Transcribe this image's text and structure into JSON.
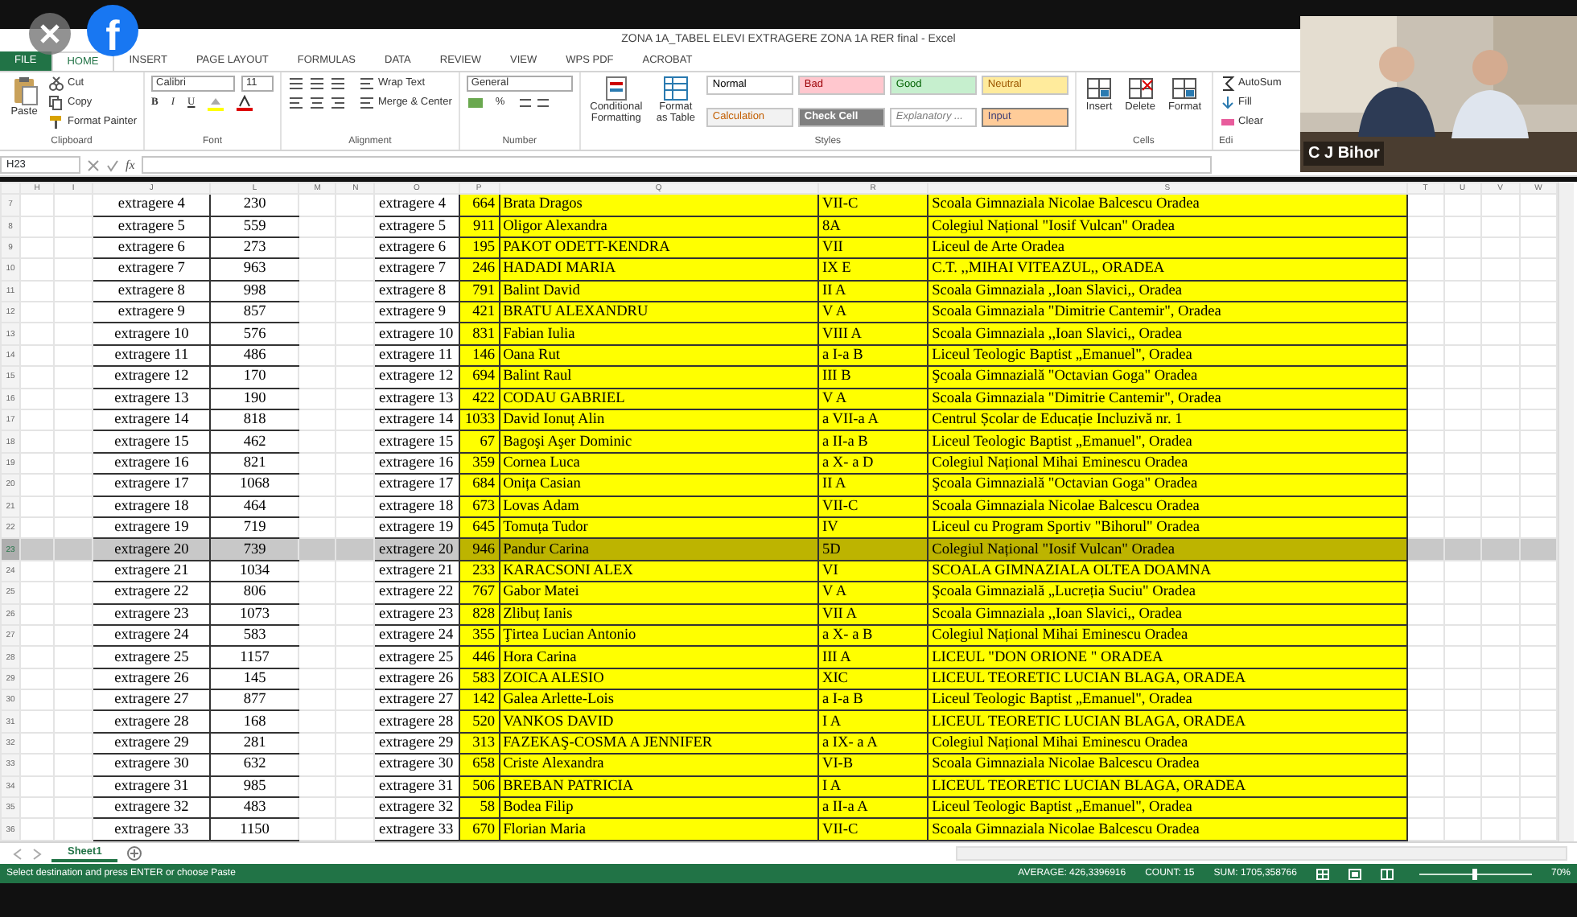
{
  "overlay": {
    "logo_text": "f"
  },
  "camera": {
    "kind": "picture",
    "caption": "C J Bihor"
  },
  "window": {
    "title": "ZONA 1A_TABEL ELEVI EXTRAGERE ZONA 1A RER final - Excel"
  },
  "ribbon_tabs": [
    {
      "label": "FILE",
      "kind": "file",
      "selected": false
    },
    {
      "label": "HOME",
      "kind": "tab",
      "selected": true
    },
    {
      "label": "INSERT",
      "kind": "tab",
      "selected": false
    },
    {
      "label": "PAGE LAYOUT",
      "kind": "tab",
      "selected": false
    },
    {
      "label": "FORMULAS",
      "kind": "tab",
      "selected": false
    },
    {
      "label": "DATA",
      "kind": "tab",
      "selected": false
    },
    {
      "label": "REVIEW",
      "kind": "tab",
      "selected": false
    },
    {
      "label": "VIEW",
      "kind": "tab",
      "selected": false
    },
    {
      "label": "WPS PDF",
      "kind": "tab",
      "selected": false
    },
    {
      "label": "ACROBAT",
      "kind": "tab",
      "selected": false
    }
  ],
  "ribbon": [
    {
      "kind": "clipboard",
      "label": "Clipboard",
      "items": [
        "Paste",
        "Cut",
        "Copy",
        "Format Painter"
      ]
    },
    {
      "kind": "font",
      "label": "Font",
      "items": [
        "Calibri",
        "11",
        "B",
        "I",
        "U"
      ]
    },
    {
      "kind": "alignment",
      "label": "Alignment",
      "items": [
        "Wrap Text",
        "Merge & Center"
      ]
    },
    {
      "kind": "number",
      "label": "Number",
      "items": [
        "General",
        "%"
      ]
    },
    {
      "kind": "styles",
      "label": "Styles",
      "items": [
        "Conditional Formatting",
        "Format as Table"
      ],
      "styles": [
        {
          "label": "Normal",
          "kind": "normal",
          "color": "#ffffff"
        },
        {
          "label": "Bad",
          "kind": "bad",
          "color": "#ffc7ce"
        },
        {
          "label": "Good",
          "kind": "good",
          "color": "#c6efce"
        },
        {
          "label": "Neutral",
          "kind": "neutral",
          "color": "#ffeb9c"
        },
        {
          "label": "Calculation",
          "kind": "calculation",
          "color": "#f2f2f2"
        },
        {
          "label": "Check Cell",
          "kind": "check",
          "color": "#7f7f7f"
        },
        {
          "label": "Explanatory ...",
          "kind": "explanatory",
          "color": "#ffffff"
        },
        {
          "label": "Input",
          "kind": "input",
          "color": "#ffcc99"
        }
      ]
    },
    {
      "kind": "cells",
      "label": "Cells",
      "items": [
        "Insert",
        "Delete",
        "Format"
      ]
    },
    {
      "kind": "editing",
      "label": "Edi",
      "items": [
        "AutoSum",
        "Fill",
        "Clear"
      ]
    }
  ],
  "formula_bar": {
    "name_box": "H23",
    "function_label": "fx"
  },
  "columns": [
    "H",
    "I",
    "J",
    "L",
    "M",
    "N",
    "O",
    "P",
    "Q",
    "R",
    "S",
    "T",
    "U",
    "V",
    "W"
  ],
  "rows": [
    {
      "row": "7",
      "left_label": "extragere 4",
      "left_number": "230",
      "label": "extragere 4",
      "number": "664",
      "name": "Brata Dragos",
      "class": "VII-C",
      "school": "Scoala Gimnaziala Nicolae Balcescu Oradea",
      "selected": false
    },
    {
      "row": "8",
      "left_label": "extragere 5",
      "left_number": "559",
      "label": "extragere 5",
      "number": "911",
      "name": "Oligor Alexandra",
      "class": "8A",
      "school": "Colegiul Național \"Iosif Vulcan\" Oradea",
      "selected": false
    },
    {
      "row": "9",
      "left_label": "extragere 6",
      "left_number": "273",
      "label": "extragere 6",
      "number": "195",
      "name": "PAKOT ODETT-KENDRA",
      "class": "VII",
      "school": "Liceul de Arte Oradea",
      "selected": false
    },
    {
      "row": "10",
      "left_label": "extragere 7",
      "left_number": "963",
      "label": "extragere 7",
      "number": "246",
      "name": "HADADI MARIA",
      "class": "IX E",
      "school": "C.T. ,,MIHAI VITEAZUL,, ORADEA",
      "selected": false
    },
    {
      "row": "11",
      "left_label": "extragere 8",
      "left_number": "998",
      "label": "extragere 8",
      "number": "791",
      "name": "Balint David",
      "class": "II A",
      "school": "Scoala Gimnaziala ,,Ioan Slavici,, Oradea",
      "selected": false
    },
    {
      "row": "12",
      "left_label": "extragere 9",
      "left_number": "857",
      "label": "extragere 9",
      "number": "421",
      "name": "BRATU ALEXANDRU",
      "class": "V A",
      "school": "Scoala Gimnaziala \"Dimitrie Cantemir\", Oradea",
      "selected": false
    },
    {
      "row": "13",
      "left_label": "extragere 10",
      "left_number": "576",
      "label": "extragere 10",
      "number": "831",
      "name": "Fabian Iulia",
      "class": "VIII  A",
      "school": "Scoala Gimnaziala ,,Ioan Slavici,, Oradea",
      "selected": false
    },
    {
      "row": "14",
      "left_label": "extragere 11",
      "left_number": "486",
      "label": "extragere 11",
      "number": "146",
      "name": "Oana Rut",
      "class": "a I-a B",
      "school": "Liceul Teologic Baptist „Emanuel\", Oradea",
      "selected": false
    },
    {
      "row": "15",
      "left_label": "extragere 12",
      "left_number": "170",
      "label": "extragere 12",
      "number": "694",
      "name": "Balint Raul",
      "class": "III B",
      "school": "Şcoala Gimnazială \"Octavian Goga\" Oradea",
      "selected": false
    },
    {
      "row": "16",
      "left_label": "extragere 13",
      "left_number": "190",
      "label": "extragere 13",
      "number": "422",
      "name": "CODAU GABRIEL",
      "class": "V A",
      "school": "Scoala Gimnaziala \"Dimitrie Cantemir\", Oradea",
      "selected": false
    },
    {
      "row": "17",
      "left_label": "extragere 14",
      "left_number": "818",
      "label": "extragere 14",
      "number": "1033",
      "name": "David Ionuț Alin",
      "class": "a VII-a A",
      "school": "Centrul Școlar de Educație Incluzivă nr. 1",
      "selected": false
    },
    {
      "row": "18",
      "left_label": "extragere 15",
      "left_number": "462",
      "label": "extragere 15",
      "number": "67",
      "name": "Bagoşi Aşer Dominic",
      "class": "a II-a B",
      "school": "Liceul Teologic Baptist „Emanuel\", Oradea",
      "selected": false
    },
    {
      "row": "19",
      "left_label": "extragere 16",
      "left_number": "821",
      "label": "extragere 16",
      "number": "359",
      "name": "Cornea Luca",
      "class": "a X- a D",
      "school": "Colegiul Național Mihai Eminescu Oradea",
      "selected": false
    },
    {
      "row": "20",
      "left_label": "extragere 17",
      "left_number": "1068",
      "label": "extragere 17",
      "number": "684",
      "name": "Onița Casian",
      "class": "II A",
      "school": "Şcoala Gimnazială \"Octavian Goga\" Oradea",
      "selected": false
    },
    {
      "row": "21",
      "left_label": "extragere 18",
      "left_number": "464",
      "label": "extragere 18",
      "number": "673",
      "name": "Lovas Adam",
      "class": "VII-C",
      "school": "Scoala Gimnaziala Nicolae Balcescu Oradea",
      "selected": false
    },
    {
      "row": "22",
      "left_label": "extragere 19",
      "left_number": "719",
      "label": "extragere 19",
      "number": "645",
      "name": "Tomuța Tudor",
      "class": "IV",
      "school": "Liceul cu Program Sportiv \"Bihorul\" Oradea",
      "selected": false
    },
    {
      "row": "23",
      "left_label": "extragere 20",
      "left_number": "739",
      "label": "extragere 20",
      "number": "946",
      "name": "Pandur Carina",
      "class": "5D",
      "school": "Colegiul Național \"Iosif Vulcan\" Oradea",
      "selected": true
    },
    {
      "row": "24",
      "left_label": "extragere 21",
      "left_number": "1034",
      "label": "extragere 21",
      "number": "233",
      "name": "KARACSONI ALEX",
      "class": "VI",
      "school": "SCOALA GIMNAZIALA OLTEA DOAMNA",
      "selected": false
    },
    {
      "row": "25",
      "left_label": "extragere 22",
      "left_number": "806",
      "label": "extragere 22",
      "number": "767",
      "name": "Gabor Matei",
      "class": "V A",
      "school": "Şcoala Gimnazială „Lucreția Suciu\" Oradea",
      "selected": false
    },
    {
      "row": "26",
      "left_label": "extragere 23",
      "left_number": "1073",
      "label": "extragere 23",
      "number": "828",
      "name": "Zlibuț Ianis",
      "class": "VII  A",
      "school": "Scoala Gimnaziala ,,Ioan Slavici,, Oradea",
      "selected": false
    },
    {
      "row": "27",
      "left_label": "extragere 24",
      "left_number": "583",
      "label": "extragere 24",
      "number": "355",
      "name": "Ţirtea Lucian Antonio",
      "class": "a X- a B",
      "school": "Colegiul Național Mihai Eminescu Oradea",
      "selected": false
    },
    {
      "row": "28",
      "left_label": "extragere 25",
      "left_number": "1157",
      "label": "extragere 25",
      "number": "446",
      "name": "Hora Carina",
      "class": "III A",
      "school": "LICEUL \"DON ORIONE \" ORADEA",
      "selected": false
    },
    {
      "row": "29",
      "left_label": "extragere 26",
      "left_number": "145",
      "label": "extragere 26",
      "number": "583",
      "name": "ZOICA ALESIO",
      "class": "XIC",
      "school": "LICEUL TEORETIC LUCIAN BLAGA, ORADEA",
      "selected": false
    },
    {
      "row": "30",
      "left_label": "extragere 27",
      "left_number": "877",
      "label": "extragere 27",
      "number": "142",
      "name": "Galea Arlette-Lois",
      "class": "a I-a B",
      "school": "Liceul Teologic Baptist „Emanuel\", Oradea",
      "selected": false
    },
    {
      "row": "31",
      "left_label": "extragere 28",
      "left_number": "168",
      "label": "extragere 28",
      "number": "520",
      "name": "VANKOS DAVID",
      "class": "I A",
      "school": "LICEUL TEORETIC LUCIAN BLAGA, ORADEA",
      "selected": false
    },
    {
      "row": "32",
      "left_label": "extragere 29",
      "left_number": "281",
      "label": "extragere 29",
      "number": "313",
      "name": "FAZEKAŞ-COSMA A JENNIFER",
      "class": "a IX- a A",
      "school": "Colegiul Național Mihai Eminescu Oradea",
      "selected": false
    },
    {
      "row": "33",
      "left_label": "extragere 30",
      "left_number": "632",
      "label": "extragere 30",
      "number": "658",
      "name": "Criste Alexandra",
      "class": "VI-B",
      "school": "Scoala Gimnaziala Nicolae Balcescu Oradea",
      "selected": false
    },
    {
      "row": "34",
      "left_label": "extragere 31",
      "left_number": "985",
      "label": "extragere 31",
      "number": "506",
      "name": "BREBAN PATRICIA",
      "class": "I A",
      "school": "LICEUL TEORETIC LUCIAN BLAGA, ORADEA",
      "selected": false
    },
    {
      "row": "35",
      "left_label": "extragere 32",
      "left_number": "483",
      "label": "extragere 32",
      "number": "58",
      "name": "Bodea Filip",
      "class": "a II-a A",
      "school": "Liceul Teologic Baptist „Emanuel\", Oradea",
      "selected": false
    },
    {
      "row": "36",
      "left_label": "extragere 33",
      "left_number": "1150",
      "label": "extragere 33",
      "number": "670",
      "name": "Florian Maria",
      "class": "VII-C",
      "school": "Scoala Gimnaziala Nicolae Balcescu Oradea",
      "selected": false
    }
  ],
  "sheet_tabs": [
    {
      "label": "Sheet1",
      "selected": true
    }
  ],
  "status_bar": {
    "message": "Select destination and press ENTER or choose Paste",
    "stats": [
      "AVERAGE: 426,3396916",
      "COUNT: 15",
      "SUM: 1705,358766"
    ],
    "zoom": "70%",
    "zoom_slider": {
      "level": 0.5
    }
  }
}
